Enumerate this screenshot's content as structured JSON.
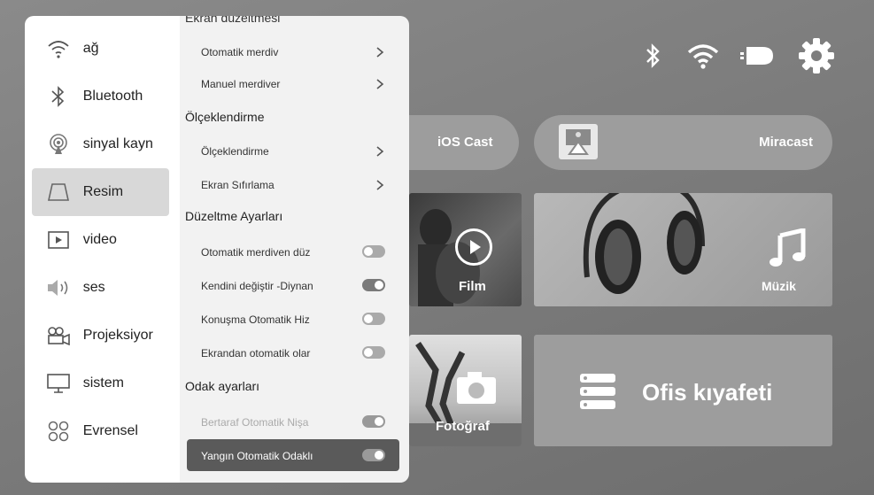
{
  "status_icons": [
    "bluetooth-icon",
    "wifi-icon",
    "input-source-icon",
    "settings-gear-icon"
  ],
  "menu": {
    "items": [
      {
        "label": "ağ",
        "icon": "wifi-icon"
      },
      {
        "label": "Bluetooth",
        "icon": "bluetooth-icon"
      },
      {
        "label": "sinyal kayn",
        "icon": "signal-source-icon"
      },
      {
        "label": "Resim",
        "icon": "picture-icon",
        "active": true
      },
      {
        "label": "video",
        "icon": "video-icon"
      },
      {
        "label": "ses",
        "icon": "sound-icon"
      },
      {
        "label": "Projeksiyor",
        "icon": "projector-icon"
      },
      {
        "label": "sistem",
        "icon": "monitor-icon"
      },
      {
        "label": "Evrensel",
        "icon": "universal-icon"
      }
    ]
  },
  "panel": {
    "top_cut": "Ekran düzeltmesi",
    "rows": [
      {
        "type": "item",
        "label": "Otomatik merdiv",
        "control": "chevron"
      },
      {
        "type": "item",
        "label": "Manuel merdiver",
        "control": "chevron"
      },
      {
        "type": "section",
        "label": "Ölçeklendirme"
      },
      {
        "type": "item",
        "label": "Ölçeklendirme",
        "control": "chevron"
      },
      {
        "type": "item",
        "label": "Ekran Sıfırlama",
        "control": "chevron"
      },
      {
        "type": "section",
        "label": "Düzeltme Ayarları"
      },
      {
        "type": "item",
        "label": "Otomatik merdiven düz",
        "control": "toggle",
        "on": false
      },
      {
        "type": "item",
        "label": "Kendini değiştir -Diynan",
        "control": "toggle",
        "on": true
      },
      {
        "type": "item",
        "label": "Konuşma Otomatik Hiz",
        "control": "toggle",
        "on": false
      },
      {
        "type": "item",
        "label": "Ekrandan otomatik olar",
        "control": "toggle",
        "on": false
      },
      {
        "type": "section",
        "label": "Odak ayarları"
      },
      {
        "type": "item",
        "label": "Bertaraf Otomatik Nişa",
        "control": "toggle",
        "on": true,
        "dim": true
      },
      {
        "type": "item",
        "label": "Yangın Otomatik Odaklı",
        "control": "toggle",
        "on": true,
        "selected": true
      }
    ]
  },
  "home": {
    "ios_cast": "iOS Cast",
    "miracast": "Miracast",
    "film": "Film",
    "music": "Müzik",
    "photo": "Fotoğraf",
    "office": "Ofis kıyafeti"
  },
  "colors": {
    "menu_active": "#d8d8d8",
    "selected_row": "#5a5a5a",
    "panel": "#f2f2f2",
    "tile": "#9d9d9d"
  }
}
